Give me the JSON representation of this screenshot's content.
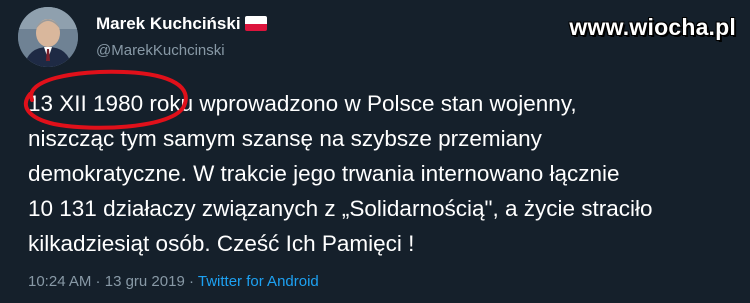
{
  "header": {
    "display_name": "Marek Kuchciński",
    "handle": "@MarekKuchcinski",
    "flag_icon": "poland-flag-icon"
  },
  "watermark": "www.wiocha.pl",
  "tweet": {
    "lines": [
      "13 XII 1980 roku wprowadzono w Polsce stan wojenny,",
      "niszcząc tym samym szansę na szybsze przemiany",
      "demokratyczne. W trakcie jego trwania internowano łącznie",
      "10 131 działaczy związanych z „Solidarnością\", a życie straciło",
      "kilkadziesiąt osób. Cześć Ich Pamięci !"
    ]
  },
  "meta": {
    "time": "10:24 AM",
    "separator": " · ",
    "date": "13 gru 2019",
    "separator2": " · ",
    "source": "Twitter for Android"
  },
  "colors": {
    "background": "#15202b",
    "text": "#ffffff",
    "muted": "#8899a6",
    "link": "#1da1f2",
    "annotation": "#e0101a"
  }
}
